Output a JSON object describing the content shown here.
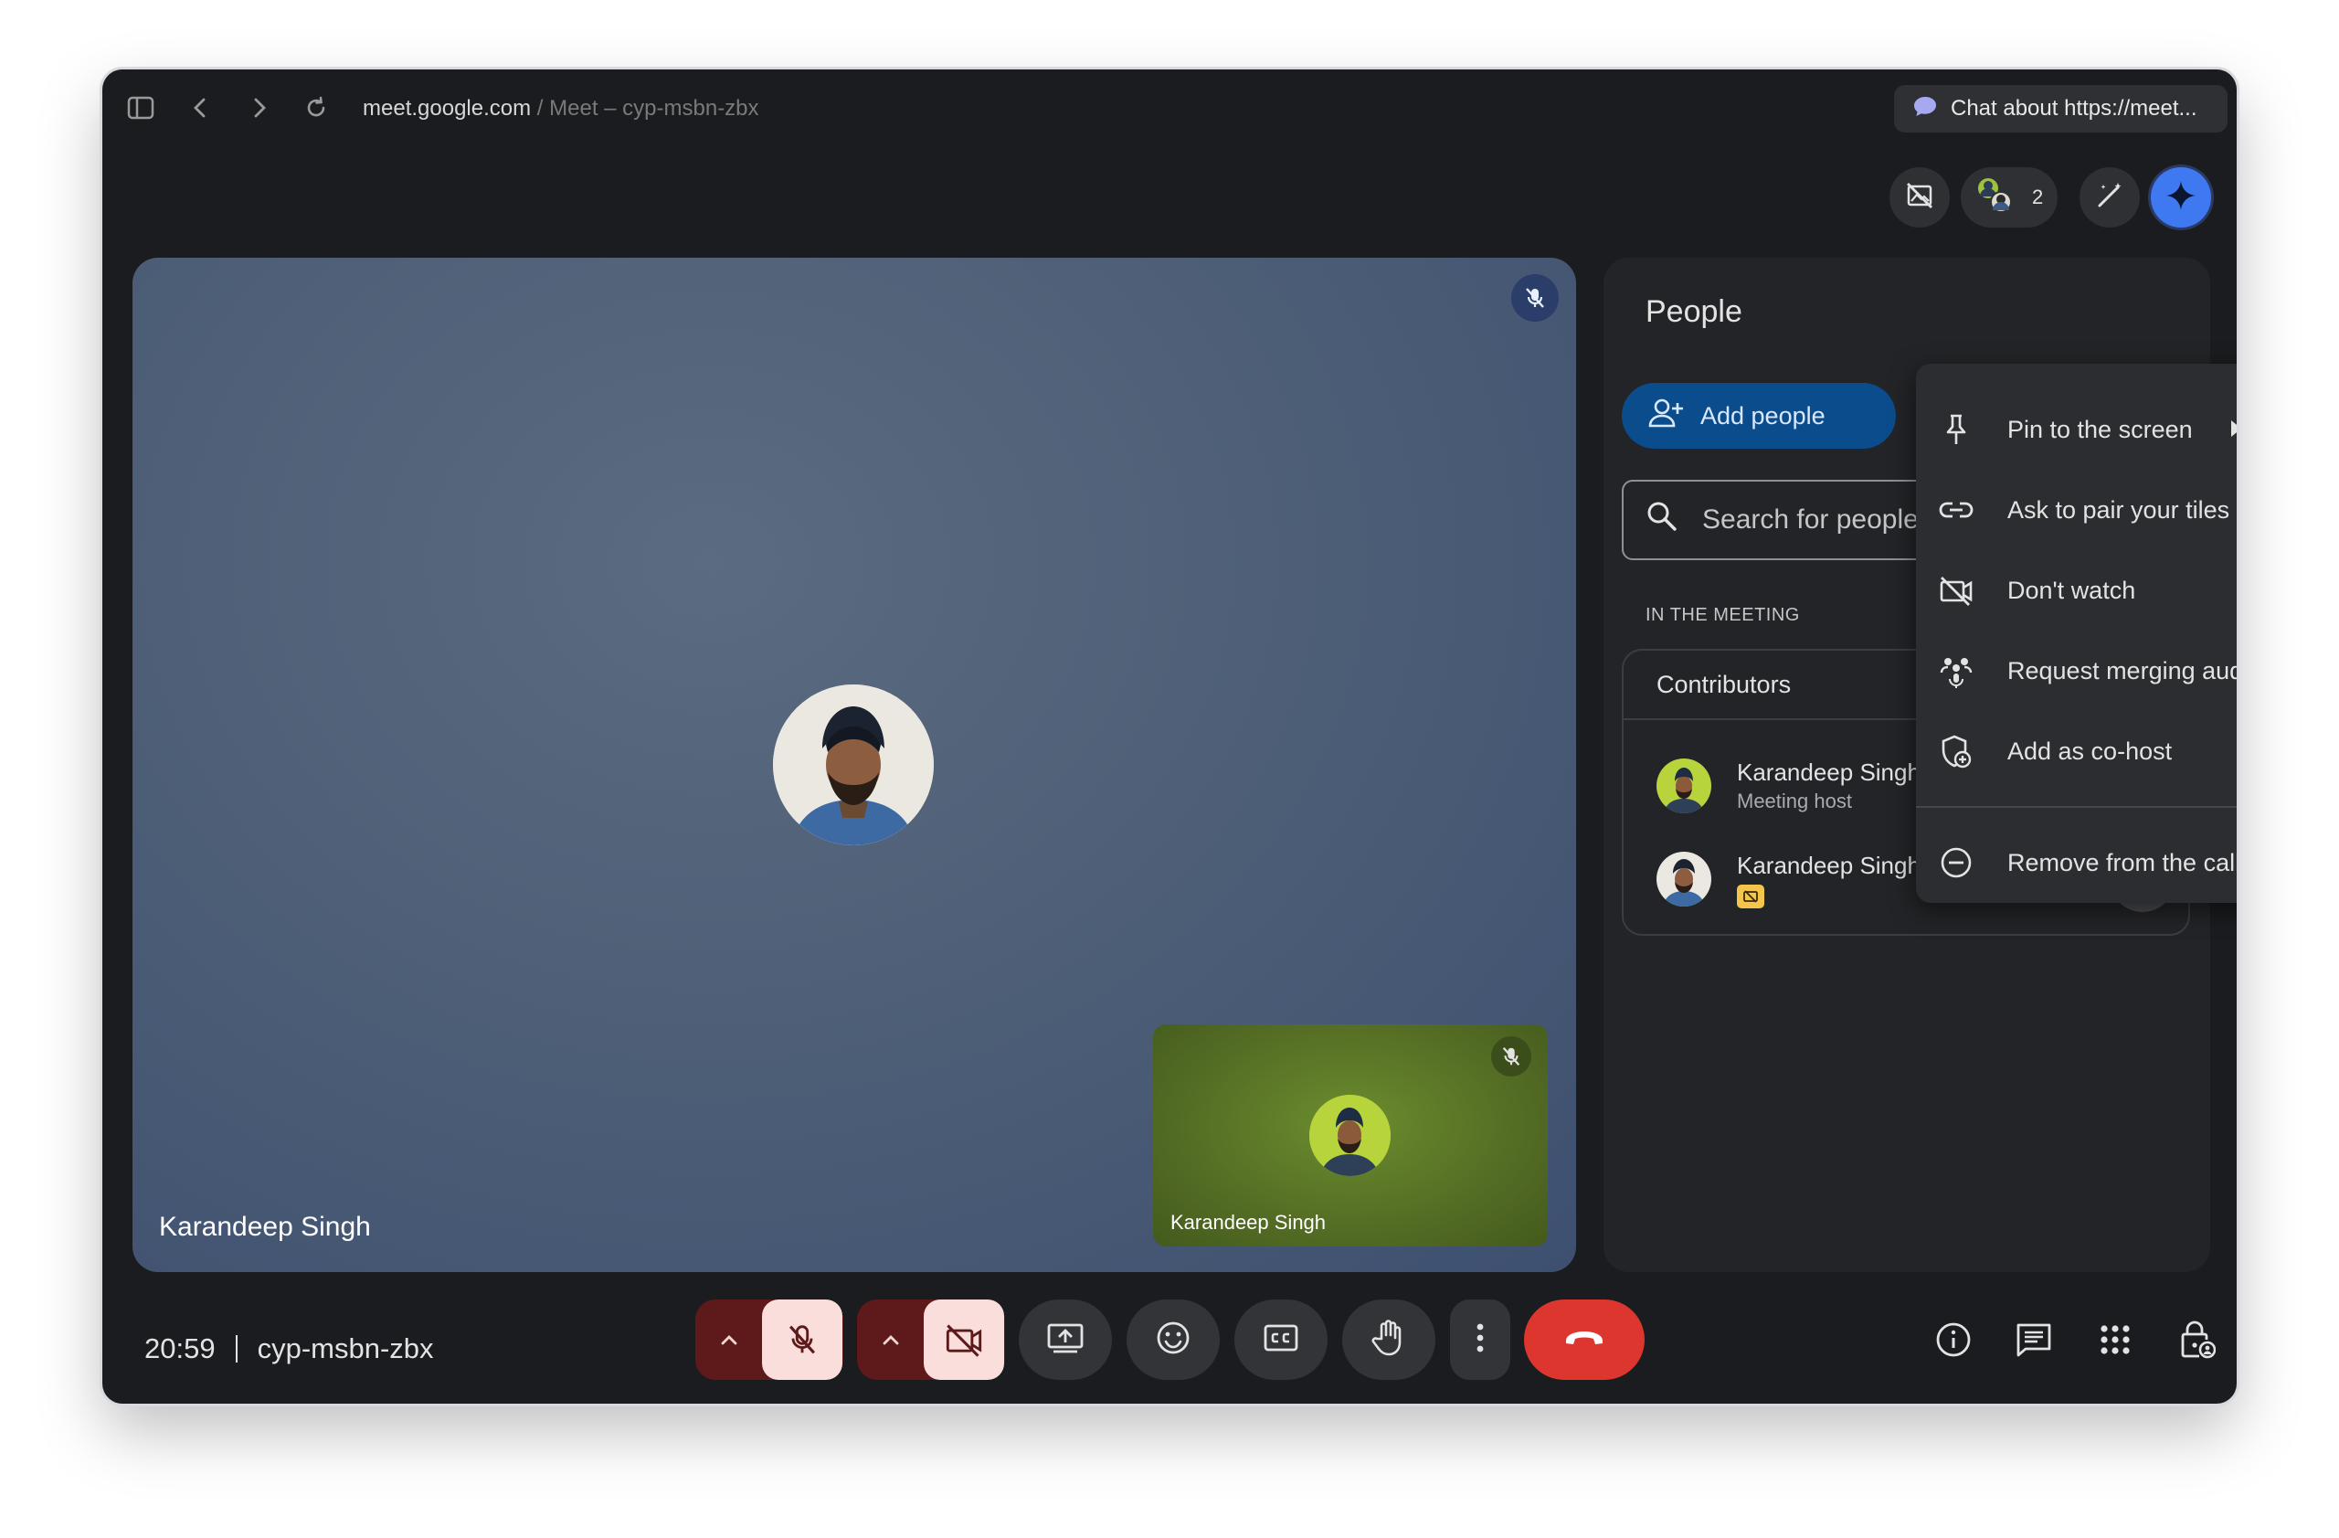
{
  "browser": {
    "url_domain": "meet.google.com",
    "url_separator": " / ",
    "page_title": "Meet – cyp-msbn-zbx",
    "chat_button": "Chat about https://meet..."
  },
  "top_controls": {
    "participant_count": "2"
  },
  "stage": {
    "main_name": "Karandeep Singh",
    "pip_name": "Karandeep Singh"
  },
  "people_panel": {
    "title": "People",
    "add_people": "Add people",
    "search_placeholder": "Search for people",
    "section_label": "IN THE MEETING",
    "contributors": "Contributors",
    "participants": [
      {
        "name": "Karandeep Singh",
        "subtitle": "Meeting host"
      },
      {
        "name": "Karandeep Singh"
      }
    ]
  },
  "context_menu": {
    "items": [
      {
        "label": "Pin to the screen",
        "icon": "pin-icon"
      },
      {
        "label": "Ask to pair your tiles",
        "icon": "link-icon"
      },
      {
        "label": "Don't watch",
        "icon": "video-off-icon"
      },
      {
        "label": "Request merging audio",
        "icon": "group-audio-icon"
      },
      {
        "label": "Add as co-host",
        "icon": "shield-add-icon"
      },
      {
        "label": "Remove from the call",
        "icon": "remove-circle-icon"
      }
    ]
  },
  "bottom_bar": {
    "time": "20:59",
    "meeting_code": "cyp-msbn-zbx"
  },
  "colors": {
    "end_call": "#dc362e",
    "muted_bg": "#f9dedc",
    "accent": "#3f79f2"
  }
}
